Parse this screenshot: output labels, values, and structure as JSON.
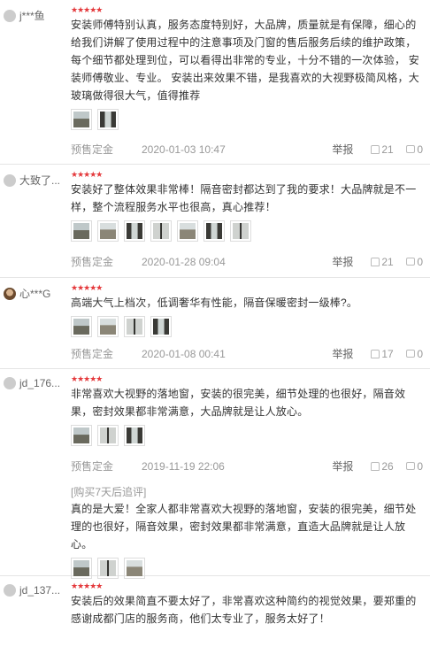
{
  "reviews": [
    {
      "username": "j***鱼",
      "stars": "★★★★★",
      "text": "安装师傅特别认真，服务态度特别好，大品牌，质量就是有保障，细心的给我们讲解了使用过程中的注意事项及门窗的售后服务后续的维护政策，每个细节都处理到位，可以看得出非常的专业，十分不错的一次体验， 安装师傅敬业、专业。 安装出来效果不错，是我喜欢的大视野极简风格，大玻璃做得很大气，值得推荐",
      "type": "预售定金",
      "date": "2020-01-03 10:47",
      "report": "举报",
      "likes": "21",
      "comments": "0"
    },
    {
      "username": "大致了...",
      "stars": "★★★★★",
      "text": "安装好了整体效果非常棒！隔音密封都达到了我的要求！大品牌就是不一样，整个流程服务水平也很高，真心推荐！",
      "type": "预售定金",
      "date": "2020-01-28 09:04",
      "report": "举报",
      "likes": "21",
      "comments": "0"
    },
    {
      "username": "心***G",
      "stars": "★★★★★",
      "text": "高端大气上档次，低调奢华有性能，隔音保暖密封一级棒?。",
      "type": "预售定金",
      "date": "2020-01-08 00:41",
      "report": "举报",
      "likes": "17",
      "comments": "0"
    },
    {
      "username": "jd_176...",
      "stars": "★★★★★",
      "text": "非常喜欢大视野的落地窗，安装的很完美，细节处理的也很好，隔音效果，密封效果都非常满意，大品牌就是让人放心。",
      "type": "预售定金",
      "date": "2019-11-19 22:06",
      "report": "举报",
      "likes": "26",
      "comments": "0",
      "followup_label": "[购买7天后追评]",
      "followup_text": "真的是大爱！全家人都非常喜欢大视野的落地窗，安装的很完美，细节处理的也很好，隔音效果，密封效果都非常满意，直造大品牌就是让人放心。"
    },
    {
      "username": "jd_137...",
      "stars": "★★★★★",
      "text": "安装后的效果简直不要太好了，非常喜欢这种简约的视觉效果，要郑重的感谢成都门店的服务商，他们太专业了，服务太好了！"
    }
  ]
}
